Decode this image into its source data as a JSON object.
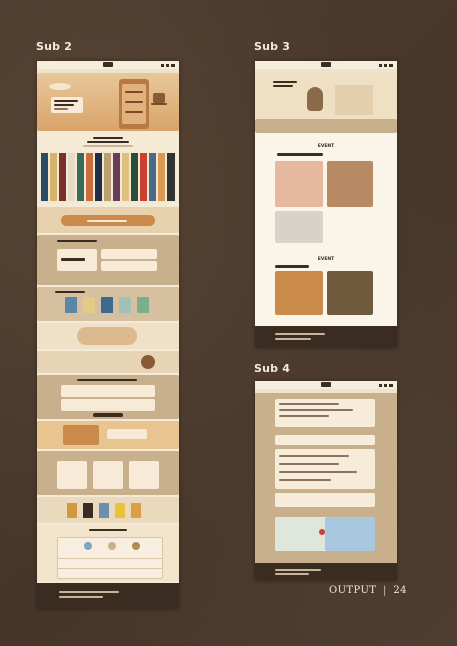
{
  "labels": {
    "sub2": "Sub 2",
    "sub3": "Sub 3",
    "sub4": "Sub 4"
  },
  "footer_mark": {
    "word": "OUTPUT",
    "separator": "|",
    "page": "24"
  },
  "sub3": {
    "event_heading_1": "EVENT",
    "event_heading_2": "EVENT"
  },
  "colors": {
    "background": "#4a3a2d",
    "cream": "#f5ead6",
    "tan": "#c9b08d",
    "dark_brown": "#3b2c21",
    "accent_orange": "#c98a4a"
  }
}
